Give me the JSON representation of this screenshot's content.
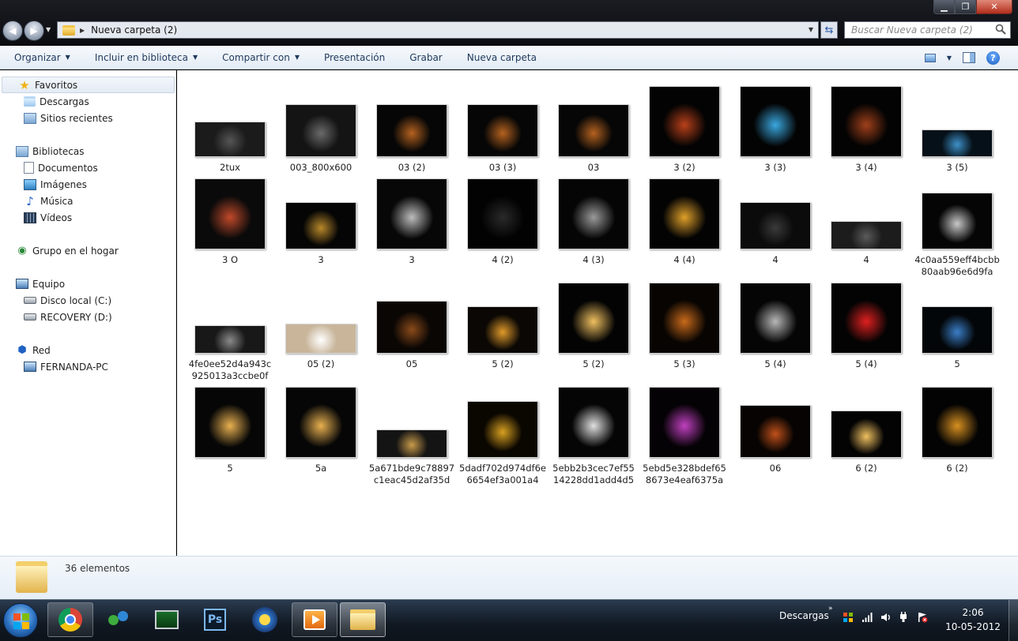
{
  "window": {
    "address_path": "Nueva carpeta (2)",
    "search_placeholder": "Buscar Nueva carpeta (2)"
  },
  "toolbar": {
    "items": [
      "Organizar",
      "Incluir en biblioteca",
      "Compartir con",
      "Presentación",
      "Grabar",
      "Nueva carpeta"
    ]
  },
  "nav": {
    "favoritos": "Favoritos",
    "descargas": "Descargas",
    "sitios_recientes": "Sitios recientes",
    "bibliotecas": "Bibliotecas",
    "documentos": "Documentos",
    "imagenes": "Imágenes",
    "musica": "Música",
    "videos": "Vídeos",
    "grupo_hogar": "Grupo en el hogar",
    "equipo": "Equipo",
    "disco_local": "Disco local (C:)",
    "recovery": "RECOVERY (D:)",
    "red": "Red",
    "fernanda_pc": "FERNANDA-PC"
  },
  "files": [
    {
      "name": "2tux",
      "bg": "#1b1b1b",
      "accent": "#555555"
    },
    {
      "name": "003_800x600",
      "bg": "#141414",
      "accent": "#6a6a6a"
    },
    {
      "name": "03 (2)",
      "bg": "#060606",
      "accent": "#b5621f"
    },
    {
      "name": "03 (3)",
      "bg": "#060606",
      "accent": "#b5621f"
    },
    {
      "name": "03",
      "bg": "#060606",
      "accent": "#b5621f"
    },
    {
      "name": "3 (2)",
      "bg": "#030303",
      "accent": "#b8401a"
    },
    {
      "name": "3 (3)",
      "bg": "#030303",
      "accent": "#3aa8e0"
    },
    {
      "name": "3 (4)",
      "bg": "#030303",
      "accent": "#a0401a"
    },
    {
      "name": "3 (5)",
      "bg": "#061018",
      "accent": "#3e90c8"
    },
    {
      "name": "3 O",
      "bg": "#0a0a0a",
      "accent": "#c0492a"
    },
    {
      "name": "3",
      "bg": "#050505",
      "accent": "#b8882a"
    },
    {
      "name": "3",
      "bg": "#070707",
      "accent": "#bdbdbd"
    },
    {
      "name": "4 (2)",
      "bg": "#020202",
      "accent": "#2a2a2a"
    },
    {
      "name": "4 (3)",
      "bg": "#050505",
      "accent": "#9a9a9a"
    },
    {
      "name": "4 (4)",
      "bg": "#030303",
      "accent": "#e0a02a"
    },
    {
      "name": "4",
      "bg": "#0b0b0b",
      "accent": "#3a3a3a"
    },
    {
      "name": "4",
      "bg": "#1c1c1c",
      "accent": "#5a5a5a"
    },
    {
      "name": "4c0aa559eff4bcbb80aab96e6d9fa",
      "bg": "#050505",
      "accent": "#c8c8c8"
    },
    {
      "name": "4fe0ee52d4a943c925013a3ccbe0f",
      "bg": "#181818",
      "accent": "#8a8a8a"
    },
    {
      "name": "05 (2)",
      "bg": "#c8b59a",
      "accent": "#ffffff"
    },
    {
      "name": "05",
      "bg": "#0a0604",
      "accent": "#8a4a1a"
    },
    {
      "name": "5 (2)",
      "bg": "#0a0704",
      "accent": "#e09a2a"
    },
    {
      "name": "5 (2)",
      "bg": "#030303",
      "accent": "#f0c060"
    },
    {
      "name": "5 (3)",
      "bg": "#080402",
      "accent": "#c86a1a"
    },
    {
      "name": "5 (4)",
      "bg": "#050505",
      "accent": "#b8b8b8"
    },
    {
      "name": "5 (4)",
      "bg": "#030303",
      "accent": "#e02020"
    },
    {
      "name": "5",
      "bg": "#030608",
      "accent": "#3a7ec8"
    },
    {
      "name": "5",
      "bg": "#060606",
      "accent": "#e8b050"
    },
    {
      "name": "5a",
      "bg": "#060606",
      "accent": "#e8b050"
    },
    {
      "name": "5a671bde9c78897c1eac45d2af35d",
      "bg": "#141414",
      "accent": "#c89a4a"
    },
    {
      "name": "5dadf702d974df6e6654ef3a001a4",
      "bg": "#0a0600",
      "accent": "#d8a020"
    },
    {
      "name": "5ebb2b3cec7ef5514228dd1add4d5",
      "bg": "#050505",
      "accent": "#e0e0e0"
    },
    {
      "name": "5ebd5e328bdef658673e4eaf6375a",
      "bg": "#050205",
      "accent": "#c040c0"
    },
    {
      "name": "06",
      "bg": "#060302",
      "accent": "#c0501a"
    },
    {
      "name": "6 (2)",
      "bg": "#030303",
      "accent": "#f0c060"
    },
    {
      "name": "6 (2)",
      "bg": "#030303",
      "accent": "#d89020"
    }
  ],
  "status": {
    "count": "36 elementos"
  },
  "taskbar": {
    "toolbar_label": "Descargas",
    "ps_label": "Ps",
    "time": "2:06",
    "date": "10-05-2012"
  }
}
